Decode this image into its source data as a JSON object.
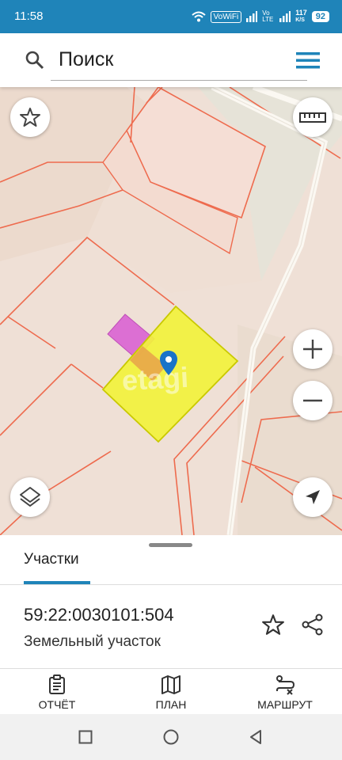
{
  "status": {
    "time": "11:58",
    "wifi_label": "VoWiFi",
    "lte_label": "Vo LTE",
    "speed": "117",
    "speed_unit": "K/S",
    "battery": "92"
  },
  "search": {
    "placeholder": "Поиск"
  },
  "map": {
    "watermark": "etagi"
  },
  "sheet": {
    "tab_label": "Участки",
    "cadastral_number": "59:22:0030101:504",
    "parcel_type": "Земельный участок"
  },
  "toolbar": {
    "report_label": "ОТЧЁТ",
    "plan_label": "ПЛАН",
    "route_label": "МАРШРУТ"
  },
  "colors": {
    "accent": "#1f84b9",
    "parcel_fill": "#f2f23c",
    "parcel_stroke": "#c9c900",
    "boundary": "#ee6b4e"
  }
}
